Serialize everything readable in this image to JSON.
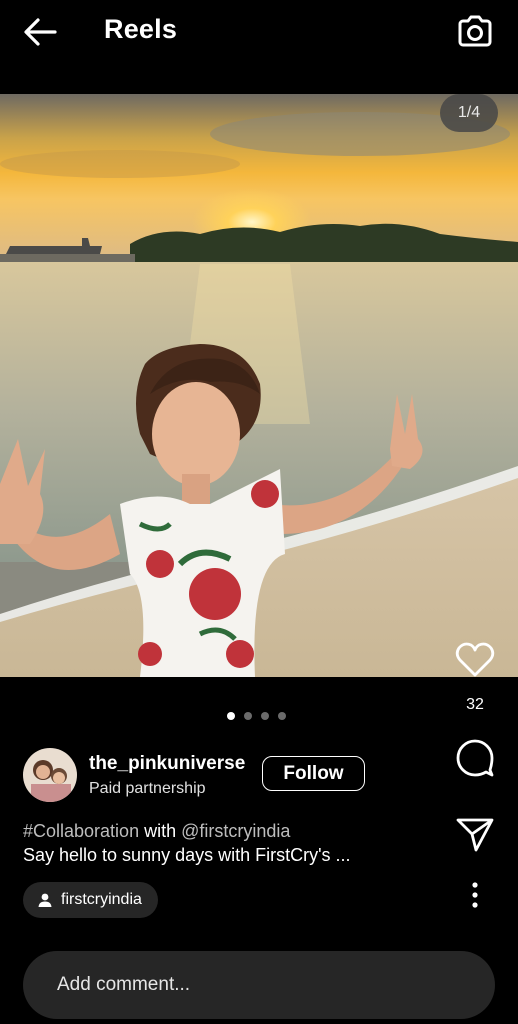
{
  "header": {
    "title": "Reels",
    "back_icon": "arrow-left-icon",
    "camera_icon": "camera-icon"
  },
  "media": {
    "counter": "1/4",
    "carousel_dots": 4,
    "active_dot": 0
  },
  "actions": {
    "like_icon": "heart-icon",
    "like_count": "32",
    "comment_icon": "comment-icon",
    "share_icon": "send-icon",
    "more_icon": "more-vertical-icon"
  },
  "author": {
    "username": "the_pinkuniverse",
    "subtitle": "Paid partnership",
    "follow_label": "Follow"
  },
  "caption": {
    "hashtag": "#Collaboration",
    "with": "with",
    "mention": "@firstcryindia",
    "text": "Say hello to sunny days with FirstCry's ..."
  },
  "tag": {
    "label": "firstcryindia",
    "icon": "person-icon"
  },
  "comment": {
    "placeholder": "Add comment..."
  }
}
